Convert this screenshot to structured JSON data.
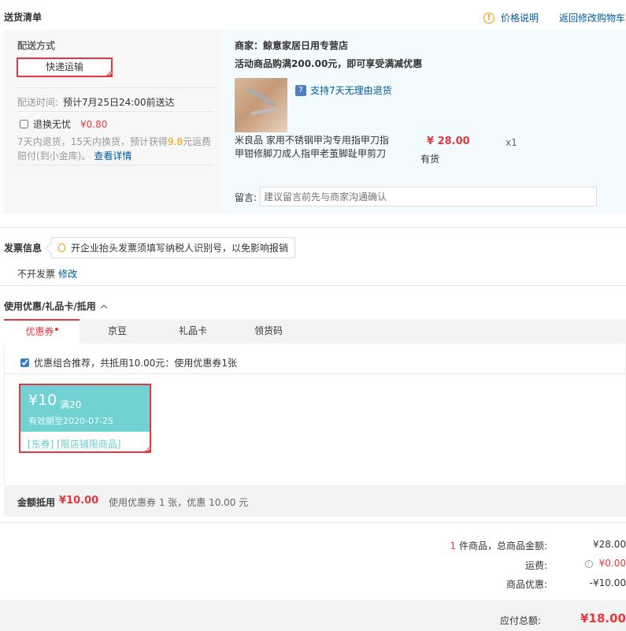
{
  "header": {
    "title": "送货清单",
    "price_info": "价格说明",
    "back_to_cart": "返回修改购物车"
  },
  "shipping": {
    "title": "配送方式",
    "method": "快递运输",
    "time_label": "配送时间:",
    "time_value": "预计7月25日24:00前送达",
    "return_label": "退换无忧",
    "return_price": "¥0.80",
    "return_desc_a": "7天内退货，15天内换货，预计获得",
    "return_desc_highlight": "9.8",
    "return_desc_b": "元运费赔付(到小金库)。",
    "return_link": "查看详情"
  },
  "order": {
    "merchant": "商家：鲸意家居日用专营店",
    "promo": "活动商品购满200.00元，即可享受满减优惠",
    "support": "支持7天无理由退货",
    "product_name": "米良品 家用不锈钢甲沟专用指甲刀指甲钳修脚刀成人指甲老茧脚趾甲剪刀",
    "price": "¥ 28.00",
    "stock": "有货",
    "qty": "x1",
    "message_label": "留言:",
    "message_placeholder": "建议留言前先与商家沟通确认"
  },
  "invoice": {
    "title": "发票信息",
    "tip": "开企业抬头发票须填写纳税人识别号，以免影响报销",
    "value": "不开发票",
    "edit_link": "修改"
  },
  "coupons": {
    "section_title": "使用优惠/礼品卡/抵用",
    "tabs": [
      "优惠券",
      "京豆",
      "礼品卡",
      "领货码"
    ],
    "combo_text": "优惠组合推荐，共抵用10.00元：使用优惠券1张",
    "card": {
      "amount": "¥10",
      "condition": "满20",
      "expiry": "有效期至2020-07-25",
      "tags": "[东券] [限店铺限商品]"
    },
    "summary_label": "金额抵用",
    "summary_amount": "¥10.00",
    "summary_desc": "使用优惠券 1 张，优惠 10.00 元"
  },
  "totals": {
    "count": "1",
    "count_suffix": " 件商品，总商品金额:",
    "goods_amount": "¥28.00",
    "freight_label": "运费:",
    "freight_value": "¥0.00",
    "discount_label": "商品优惠:",
    "discount_value": "-¥10.00",
    "pay_label": "应付总额:",
    "pay_value": "¥18.00"
  }
}
